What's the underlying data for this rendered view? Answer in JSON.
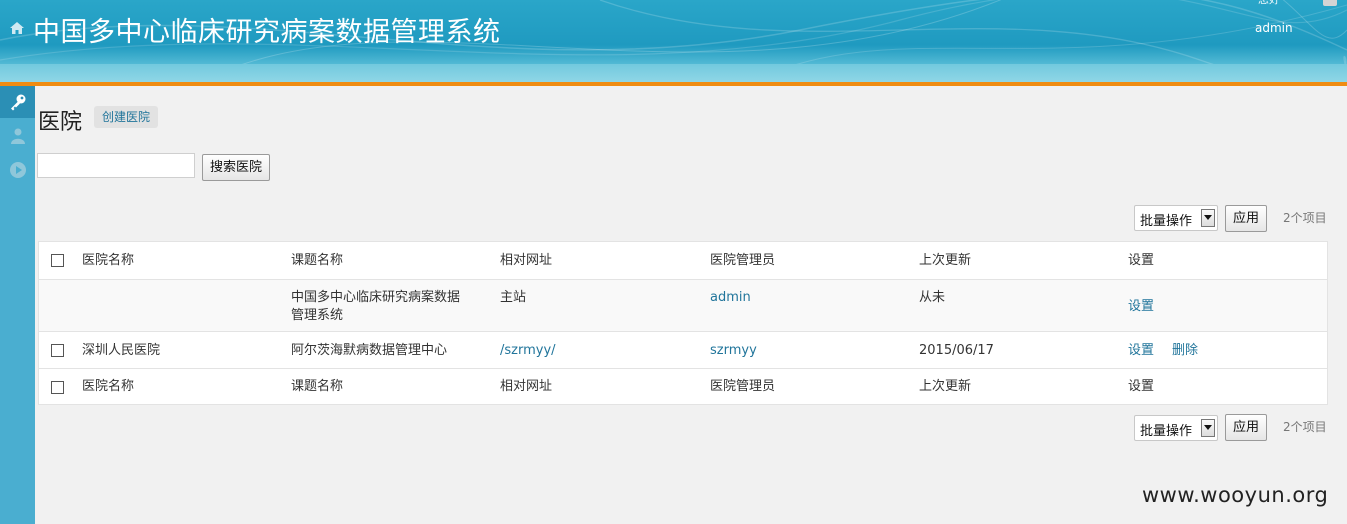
{
  "header": {
    "title": "中国多中心临床研究病案数据管理系统",
    "user_small": "您好",
    "user_name": "admin"
  },
  "sidebar": {
    "items": [
      {
        "icon": "key-icon",
        "active": true
      },
      {
        "icon": "user-icon",
        "active": false
      },
      {
        "icon": "play-circle-icon",
        "active": false
      }
    ]
  },
  "page": {
    "heading": "医院",
    "create_button": "创建医院"
  },
  "search": {
    "value": "",
    "button": "搜索医院"
  },
  "bulk_top": {
    "select": "批量操作",
    "apply": "应用",
    "count": "2个项目"
  },
  "bulk_bottom": {
    "select": "批量操作",
    "apply": "应用",
    "count": "2个项目"
  },
  "table": {
    "columns": [
      "医院名称",
      "课题名称",
      "相对网址",
      "医院管理员",
      "上次更新",
      "设置"
    ],
    "rows": [
      {
        "name": "",
        "project_line1": "中国多中心临床研究病案数据",
        "project_line2": "管理系统",
        "url": "主站",
        "admin": "admin",
        "updated": "从未",
        "settings": "设置"
      },
      {
        "name": "深圳人民医院",
        "project": "阿尔茨海默病数据管理中心",
        "url": "/szrmyy/",
        "admin": "szrmyy",
        "updated": "2015/06/17",
        "settings": "设置",
        "delete": "删除"
      }
    ]
  },
  "watermark": "www.wooyun.org",
  "colors": {
    "header": "#1f9ac0",
    "accent_bar": "#ef8c12",
    "sidebar": "#4aaed0",
    "link": "#21759b"
  }
}
